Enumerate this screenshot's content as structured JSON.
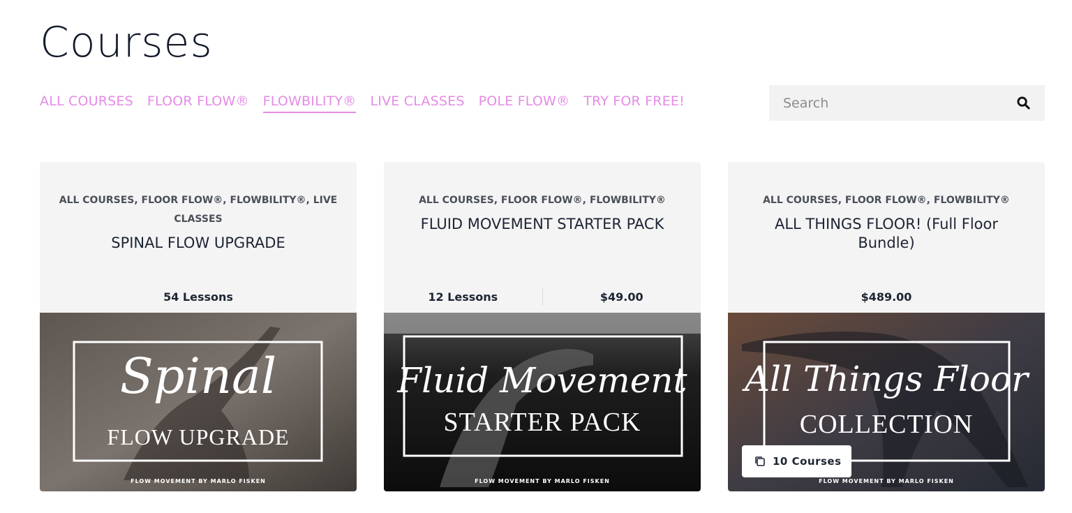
{
  "page": {
    "title": "Courses"
  },
  "tabs": [
    {
      "label": "ALL COURSES",
      "active": false
    },
    {
      "label": "FLOOR FLOW®",
      "active": false
    },
    {
      "label": "FLOWBILITY®",
      "active": true
    },
    {
      "label": "LIVE CLASSES",
      "active": false
    },
    {
      "label": "POLE FLOW®",
      "active": false
    },
    {
      "label": "TRY FOR FREE!",
      "active": false
    }
  ],
  "search": {
    "placeholder": "Search",
    "icon": "search-icon"
  },
  "colors": {
    "accent": "#e58be6",
    "card_bg": "#f4f4f4",
    "text": "#1d2433"
  },
  "cards": [
    {
      "categories": "ALL COURSES, FLOOR FLOW®, FLOWBILITY®, LIVE CLASSES",
      "title": "SPINAL FLOW UPGRADE",
      "lessons": "54 Lessons",
      "price": "",
      "image": {
        "script": "Spinal",
        "caps": "FLOW UPGRADE",
        "footer": "FLOW MOVEMENT BY MARLO FISKEN"
      }
    },
    {
      "categories": "ALL COURSES, FLOOR FLOW®, FLOWBILITY®",
      "title": "FLUID MOVEMENT STARTER PACK",
      "lessons": "12 Lessons",
      "price": "$49.00",
      "image": {
        "script": "Fluid Movement",
        "caps": "STARTER PACK",
        "footer": "FLOW MOVEMENT BY MARLO FISKEN"
      }
    },
    {
      "categories": "ALL COURSES, FLOOR FLOW®, FLOWBILITY®",
      "title": "ALL THINGS FLOOR! (Full Floor Bundle)",
      "lessons": "",
      "price": "$489.00",
      "image": {
        "script": "All Things Floor",
        "caps": "COLLECTION",
        "footer": "FLOW MOVEMENT BY MARLO FISKEN"
      },
      "badge": {
        "label": "10 Courses",
        "icon": "copy-icon"
      }
    }
  ]
}
